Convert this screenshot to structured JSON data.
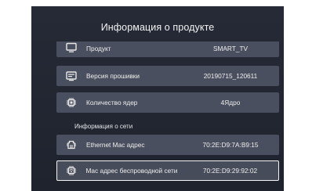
{
  "header": {
    "title": "Информация о продукте"
  },
  "rows": [
    {
      "label": "Продукт",
      "value": "SMART_TV",
      "icon": "monitor-icon"
    },
    {
      "label": "Версия прошивки",
      "value": "20190715_120611",
      "icon": "firmware-icon"
    },
    {
      "label": "Количество ядер",
      "value": "4Ядро",
      "icon": "cpu-chip-icon"
    }
  ],
  "network": {
    "section_label": "Информация о сети",
    "rows": [
      {
        "label": "Ethernet Mac адрес",
        "value": "70:2E:D9:7A:B9:15",
        "icon": "ethernet-icon"
      },
      {
        "label": "Mac адрес беспроводной сети",
        "value": "70:2E:D9:29:92:02",
        "icon": "wifi-icon"
      }
    ]
  },
  "colors": {
    "panel": "#262a36",
    "row": "#4a4f5f",
    "text": "#eeeeee",
    "focus_border": "#f4f4f4"
  }
}
